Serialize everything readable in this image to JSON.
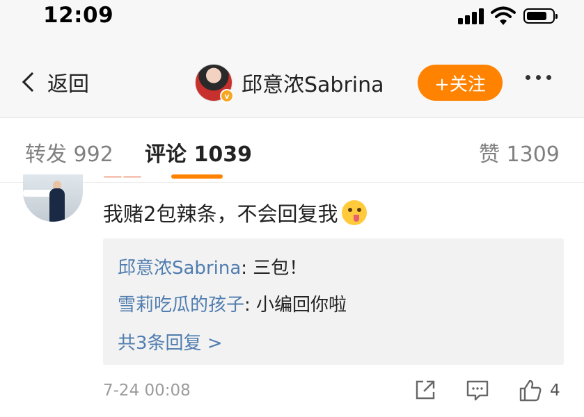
{
  "status_bar": {
    "time": "12:09"
  },
  "header": {
    "back_label": "返回",
    "username": "邱意浓Sabrina",
    "verified_badge": "v",
    "follow_label": "+关注",
    "accent_color": "#ff8200"
  },
  "tabs": [
    {
      "label": "转发 992"
    },
    {
      "label": "评论 1039",
      "active": true
    },
    {
      "label": "赞 1309"
    }
  ],
  "comment": {
    "text": "我赌2包辣条，不会回复我",
    "emoji": "tongue-out-emoji",
    "replies": [
      {
        "author": "邱意浓Sabrina",
        "text": ": 三包！"
      },
      {
        "author": "雪莉吃瓜的孩子",
        "text": ": 小编回你啦"
      }
    ],
    "more_replies": "共3条回复 >",
    "timestamp": "7-24 00:08",
    "like_count": "4"
  },
  "icons": [
    "back-chevron-icon",
    "signal-icon",
    "wifi-icon",
    "battery-icon",
    "more-icon",
    "share-icon",
    "comment-icon",
    "like-icon"
  ],
  "link_color": "#507daf"
}
